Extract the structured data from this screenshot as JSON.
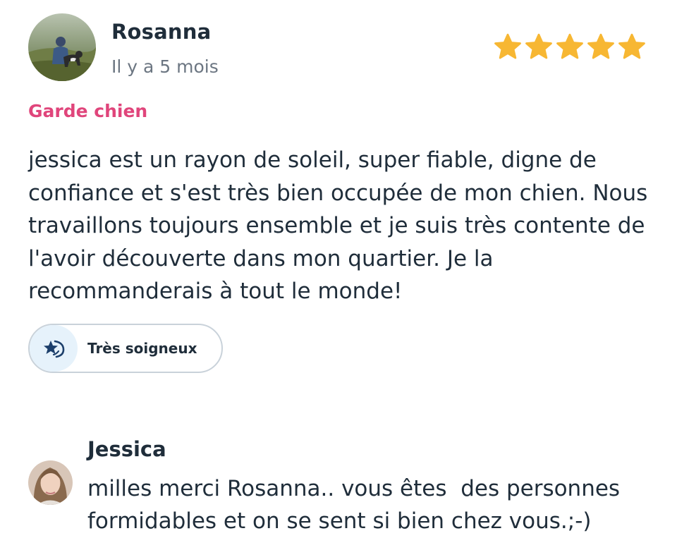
{
  "review": {
    "reviewer_name": "Rosanna",
    "time_ago": "Il y a 5 mois",
    "rating": 5,
    "max_rating": 5,
    "star_color": "#f7b733",
    "service": "Garde chien",
    "service_color": "#e0457b",
    "text": "jessica est un rayon de soleil, super fiable, digne de confiance et s'est très bien occupée de mon chien. Nous travaillons toujours ensemble et je suis très contente de l'avoir découverte dans mon quartier. Je la recommanderais à tout le monde!",
    "badge": {
      "label": "Très soigneux",
      "icon": "star-hand-icon"
    }
  },
  "reply": {
    "author_name": "Jessica",
    "text": "milles merci Rosanna.. vous êtes  des personnes formidables et on se sent si bien chez vous.;-)"
  }
}
